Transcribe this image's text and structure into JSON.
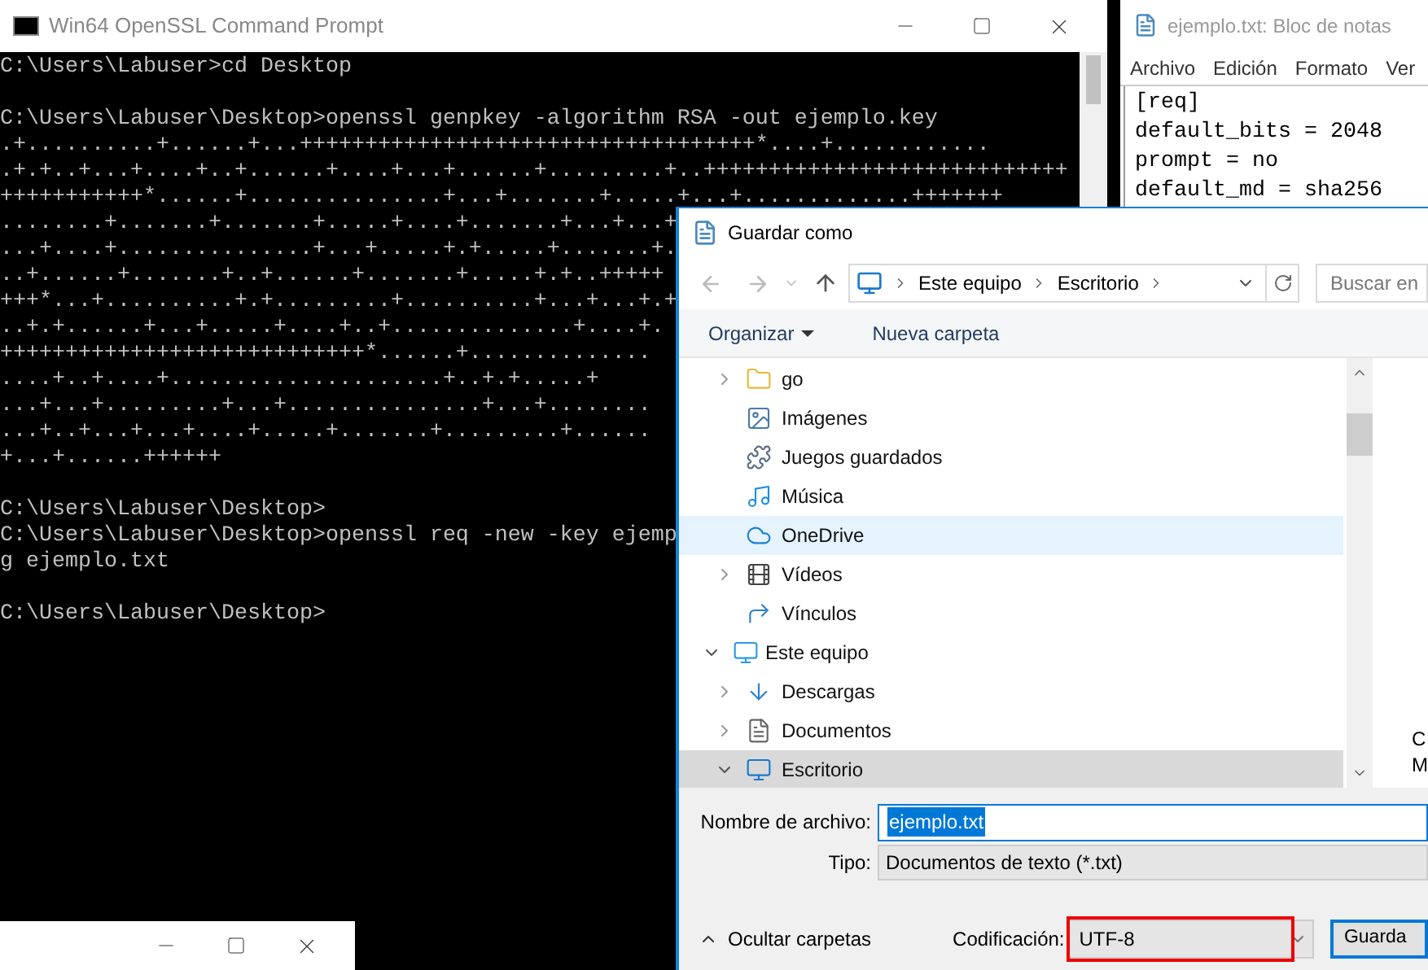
{
  "console": {
    "title": "Win64 OpenSSL Command Prompt",
    "blocks": [
      [
        "C:\\Users\\Labuser>cd Desktop"
      ],
      [
        "C:\\Users\\Labuser\\Desktop>openssl genpkey -algorithm RSA -out ejemplo.key",
        ".+..........+......+...+++++++++++++++++++++++++++++++++++*....+............",
        ".+.+..+...+....+..+......+....+...+......+.........+..++++++++++++++++++++++++++++",
        "+++++++++++*......+...............+...+.......+.....+...+.............+++++++",
        "........+.......+.......+.....+....+.......+...+...+",
        "...+....+...............+...+.....+.+.....+.......+.",
        "..+......+.......+..+......+.......+.....+.+..+++++",
        "+++*...+..........+.+.........+..........+...+...+.+",
        "..+.+......+...+.....+....+..+..............+....+.",
        "++++++++++++++++++++++++++++*......+..............",
        "....+..+....+.....................+..+.+.....+",
        "...+...+.........+...+...............+...+........",
        "...+..+...+...+....+.....+.......+.........+......",
        "+...+......++++++"
      ],
      [
        "C:\\Users\\Labuser\\Desktop>",
        "C:\\Users\\Labuser\\Desktop>openssl req -new -key ejemp",
        "g ejemplo.txt"
      ],
      [
        "C:\\Users\\Labuser\\Desktop>"
      ]
    ]
  },
  "notepad": {
    "title": "ejemplo.txt: Bloc de notas",
    "menu": [
      "Archivo",
      "Edición",
      "Formato",
      "Ver"
    ],
    "lines": [
      "[req]",
      "default_bits = 2048",
      "prompt = no",
      "default_md = sha256"
    ]
  },
  "dialog": {
    "title": "Guardar como",
    "breadcrumb": [
      "Este equipo",
      "Escritorio"
    ],
    "search": {
      "placeholder": "Buscar en"
    },
    "toolbar": {
      "organize": "Organizar",
      "new_folder": "Nueva carpeta"
    },
    "tree": [
      {
        "children": [
          {
            "label": "go",
            "kind": "folder",
            "expanded": false,
            "selected": false,
            "hovered": false
          },
          {
            "label": "Imágenes",
            "kind": "pictures",
            "selected": false,
            "hovered": false
          },
          {
            "label": "Juegos guardados",
            "kind": "games",
            "selected": false,
            "hovered": false
          },
          {
            "label": "Música",
            "kind": "music",
            "selected": false,
            "hovered": false
          },
          {
            "label": "OneDrive",
            "kind": "cloud",
            "selected": false,
            "hovered": true
          },
          {
            "label": "Vídeos",
            "kind": "videos",
            "expanded": false,
            "selected": false,
            "hovered": false
          },
          {
            "label": "Vínculos",
            "kind": "links",
            "selected": false,
            "hovered": false
          }
        ]
      },
      {
        "label": "Este equipo",
        "kind": "computer",
        "expanded": true,
        "selected": false,
        "hovered": false,
        "children": [
          {
            "label": "Descargas",
            "kind": "downloads",
            "expanded": false,
            "selected": false,
            "hovered": false
          },
          {
            "label": "Documentos",
            "kind": "documents",
            "expanded": false,
            "selected": false,
            "hovered": false
          },
          {
            "label": "Escritorio",
            "kind": "desktop",
            "expanded": true,
            "selected": true,
            "hovered": false
          }
        ]
      }
    ],
    "right_pane": [
      "C",
      "M"
    ],
    "filename": {
      "label": "Nombre de archivo:",
      "value": "ejemplo.txt"
    },
    "type": {
      "label": "Tipo:",
      "value": "Documentos de texto (*.txt)"
    },
    "hide_folders": "Ocultar carpetas",
    "encoding": {
      "label": "Codificación:",
      "value": "UTF-8"
    },
    "save_button": "Guarda"
  }
}
